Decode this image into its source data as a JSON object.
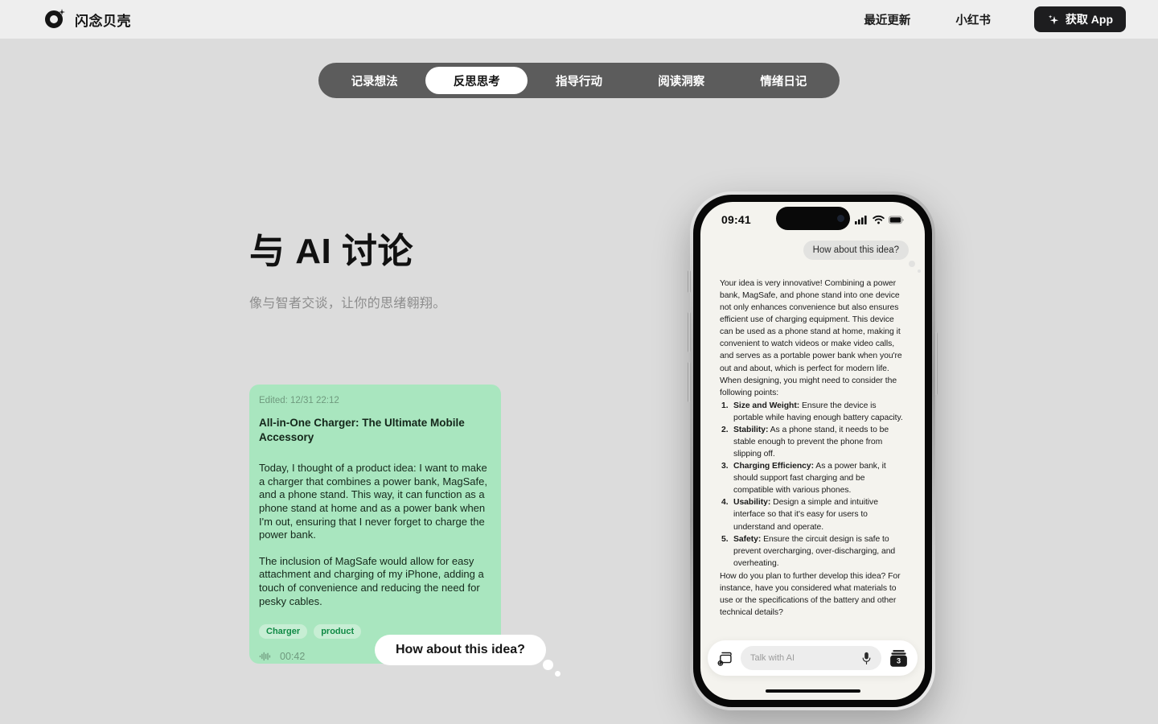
{
  "header": {
    "brand_name": "闪念贝壳",
    "logo_icon": "shell-ring-sparkle-logo",
    "nav": [
      {
        "label": "最近更新"
      },
      {
        "label": "小红书"
      }
    ],
    "get_app": {
      "label": "获取 App",
      "icon": "sparkle-icon",
      "background": "#1d1d1f"
    }
  },
  "tabs": {
    "items": [
      {
        "label": "记录想法",
        "active": false
      },
      {
        "label": "反思思考",
        "active": true
      },
      {
        "label": "指导行动",
        "active": false
      },
      {
        "label": "阅读洞察",
        "active": false
      },
      {
        "label": "情绪日记",
        "active": false
      }
    ],
    "background": "#5c5c5c",
    "active_background": "#ffffff"
  },
  "hero": {
    "title": "与 AI 讨论",
    "subtitle": "像与智者交谈，让你的思绪翱翔。"
  },
  "note_card": {
    "background": "#a9e6bf",
    "edited": "Edited: 12/31 22:12",
    "title": "All-in-One Charger: The Ultimate Mobile Accessory",
    "paragraphs": [
      "Today, I thought of a product idea: I want to make a charger that combines a power bank, MagSafe, and a phone stand. This way, it can function as a phone stand at home and as a power bank when I'm out, ensuring that I never forget to charge the power bank.",
      "The inclusion of MagSafe would allow for easy attachment and charging of my iPhone, adding a touch of convenience and reducing the need for pesky cables."
    ],
    "tags": [
      "Charger",
      "product"
    ],
    "audio": {
      "icon": "waveform-icon",
      "duration": "00:42"
    }
  },
  "speech_bubble": {
    "text": "How about this idea?"
  },
  "phone": {
    "status_bar": {
      "time": "09:41",
      "icons": [
        "cellular-signal-icon",
        "wifi-icon",
        "battery-icon"
      ]
    },
    "user_message": "How about this idea?",
    "ai_response": {
      "intro": "Your idea is very innovative! Combining a power bank, MagSafe, and phone stand into one device not only enhances convenience but also ensures efficient use of charging equipment. This device can be used as a phone stand at home, making it convenient to watch videos or make video calls, and serves as a portable power bank when you're out and about, which is perfect for modern life. When designing, you might need to consider the following points:",
      "points": [
        {
          "term": "Size and Weight:",
          "text": " Ensure the device is portable while having enough battery capacity."
        },
        {
          "term": "Stability:",
          "text": " As a phone stand, it needs to be stable enough to prevent the phone from slipping off."
        },
        {
          "term": "Charging Efficiency:",
          "text": " As a power bank, it should support fast charging and be compatible with various phones."
        },
        {
          "term": "Usability:",
          "text": " Design a simple and intuitive interface so that it's easy for users to understand and operate."
        },
        {
          "term": "Safety:",
          "text": " Ensure the circuit design is safe to prevent overcharging, over-discharging, and overheating."
        }
      ],
      "closing": "How do you plan to further develop this idea? For instance, have you considered what materials to use or the specifications of the battery and other technical details?"
    },
    "input_bar": {
      "left_icon": "add-note-icon",
      "placeholder": "Talk with  AI",
      "mic_icon": "microphone-icon",
      "stack_icon": "card-stack-icon",
      "stack_count": "3"
    }
  }
}
